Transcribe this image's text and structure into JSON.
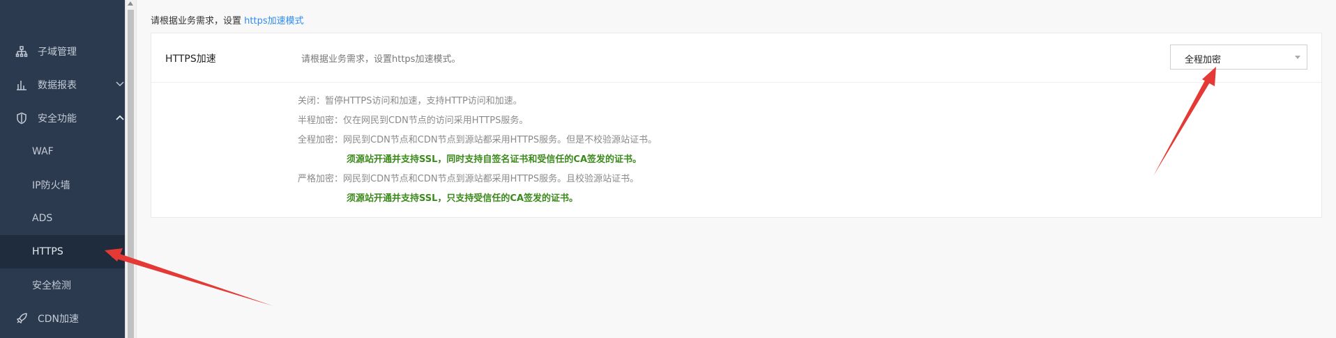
{
  "sidebar": {
    "items": [
      {
        "label": "子域管理",
        "icon": "sitemap-icon"
      },
      {
        "label": "数据报表",
        "icon": "bar-chart-icon"
      },
      {
        "label": "安全功能",
        "icon": "shield-icon"
      },
      {
        "label": "WAF"
      },
      {
        "label": "IP防火墙"
      },
      {
        "label": "ADS"
      },
      {
        "label": "HTTPS"
      },
      {
        "label": "安全检测"
      },
      {
        "label": "CDN加速",
        "icon": "rocket-icon"
      }
    ],
    "active": "HTTPS"
  },
  "main": {
    "intro_text": "请根据业务需求，设置",
    "intro_link": "https加速模式",
    "setting": {
      "title": "HTTPS加速",
      "description": "请根据业务需求，设置https加速模式。",
      "select_value": "全程加密"
    },
    "notes": [
      "关闭：暂停HTTPS访问和加速，支持HTTP访问和加速。",
      "半程加密：仅在网民到CDN节点的访问采用HTTPS服务。",
      "全程加密：网民到CDN节点和CDN节点到源站都采用HTTPS服务。但是不校验源站证书。",
      "须源站开通并支持SSL，同时支持自签名证书和受信任的CA签发的证书。",
      "严格加密：网民到CDN节点和CDN节点到源站都采用HTTPS服务。且校验源站证书。",
      "须源站开通并支持SSL，只支持受信任的CA签发的证书。"
    ]
  },
  "colors": {
    "sidebar_bg": "#2b3a4e",
    "link": "#2d8cf0",
    "green_note": "#3b8a1b",
    "annotation_arrow": "#e53935"
  }
}
